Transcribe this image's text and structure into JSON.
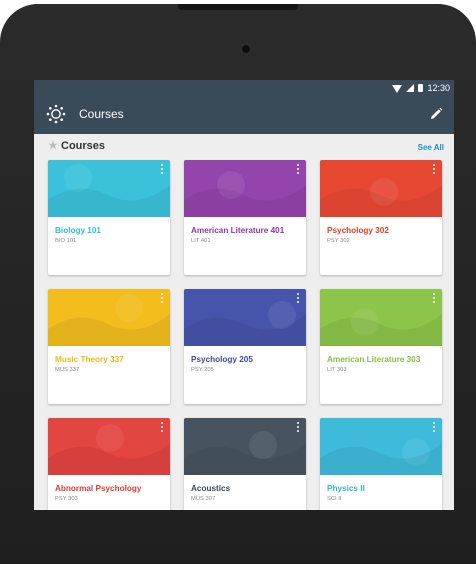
{
  "status_bar": {
    "time": "12:30"
  },
  "app_bar": {
    "title": "Courses"
  },
  "section": {
    "title": "Courses",
    "see_all": "See All"
  },
  "courses": [
    {
      "name": "Biology 101",
      "code": "BIO 101",
      "color": "#2fbfd8"
    },
    {
      "name": "American Literature 401",
      "code": "LIT 401",
      "color": "#8e3aa7"
    },
    {
      "name": "Psychology 302",
      "code": "PSY 302",
      "color": "#e63d28"
    },
    {
      "name": "Music Theory 337",
      "code": "MUS 337",
      "color": "#f2b90f"
    },
    {
      "name": "Psychology 205",
      "code": "PSY 205",
      "color": "#3c4aa6"
    },
    {
      "name": "American Literature 303",
      "code": "LIT 303",
      "color": "#86c13f"
    },
    {
      "name": "Abnormal Psychology",
      "code": "PSY 303",
      "color": "#e23a35"
    },
    {
      "name": "Acoustics",
      "code": "MUS 307",
      "color": "#3c4a55"
    },
    {
      "name": "Physics II",
      "code": "SCI II",
      "color": "#32b7d9"
    }
  ],
  "colors": {
    "app_bar": "#394b58",
    "link": "#1f8fd3"
  }
}
